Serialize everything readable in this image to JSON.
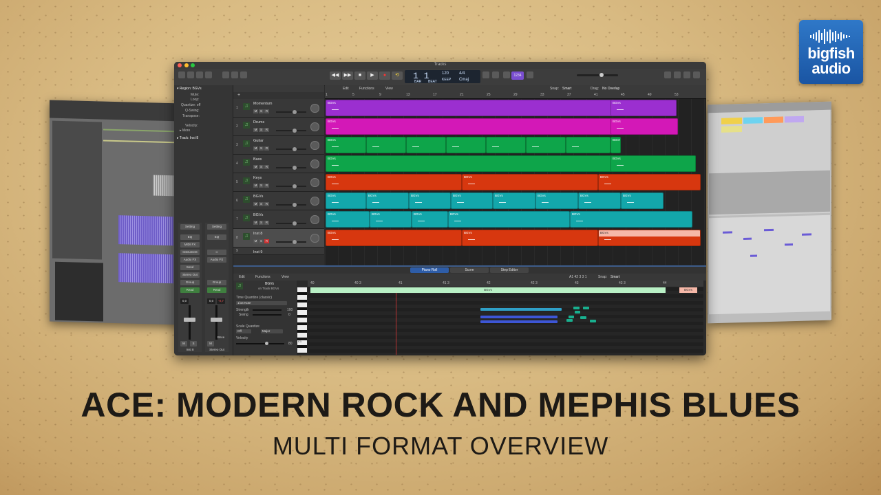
{
  "brand": {
    "line1": "bigfish",
    "line2": "audio",
    "color": "#1f5fae"
  },
  "title": "ACE: MODERN ROCK AND MEPHIS BLUES",
  "subtitle": "MULTI FORMAT OVERVIEW",
  "logic": {
    "window_title": "Tracks",
    "position_bars": "1 1",
    "tempo": "120",
    "time_signature": "4/4",
    "key": "Cmaj",
    "lcd_labels": {
      "bar": "BAR",
      "beat": "BEAT",
      "keep": "KEEP"
    },
    "counter": "1234",
    "menus": {
      "edit": "Edit",
      "functions": "Functions",
      "view": "View"
    },
    "snap_label": "Snap:",
    "snap_value": "Smart",
    "drag_label": "Drag:",
    "drag_value": "No Overlap",
    "inspector": {
      "region_header": "▾ Region: BGVs",
      "rows": [
        "Mute:",
        "Loop:",
        "Quantize:  off",
        "Q-Swing:",
        "Transpose:",
        "Velocity:",
        "▸ More"
      ],
      "track_header": "▸ Track: Inst 8",
      "strip_left": {
        "setting": "Setting",
        "eq": "EQ",
        "midi_fx": "MIDI FX",
        "instrument": "Instrument",
        "audio_fx": "Audio FX",
        "send": "Send",
        "output": "Stereo Out",
        "group": "Group",
        "auto": "Read",
        "value": "0,0",
        "m": "M",
        "s": "S",
        "name": "Inst 8"
      },
      "strip_right": {
        "setting": "Setting",
        "eq": "EQ",
        "link": "∞",
        "audio_fx": "Audio FX",
        "group": "Group",
        "auto": "Read",
        "value": "0,0",
        "value2": "-0,7",
        "m": "M",
        "bnce": "Bnce",
        "name": "Stereo Out"
      }
    },
    "ruler": [
      "1",
      "5",
      "9",
      "13",
      "17",
      "21",
      "25",
      "29",
      "33",
      "37",
      "41",
      "45",
      "49",
      "53"
    ],
    "tracks": [
      {
        "num": "1",
        "name": "Momentum",
        "m": "M",
        "s": "S",
        "r": "R"
      },
      {
        "num": "2",
        "name": "Drums",
        "m": "M",
        "s": "S",
        "r": "R"
      },
      {
        "num": "3",
        "name": "Guitar",
        "m": "M",
        "s": "S",
        "r": "R"
      },
      {
        "num": "4",
        "name": "Bass",
        "m": "M",
        "s": "S",
        "r": "R"
      },
      {
        "num": "5",
        "name": "Keys",
        "m": "M",
        "s": "S",
        "r": "R"
      },
      {
        "num": "6",
        "name": "BGVs",
        "m": "M",
        "s": "S",
        "r": "R"
      },
      {
        "num": "7",
        "name": "BGVs",
        "m": "M",
        "s": "S",
        "r": "R"
      },
      {
        "num": "8",
        "name": "Inst 8",
        "m": "M",
        "s": "S",
        "r": "R"
      },
      {
        "num": "9",
        "name": "Inst 9",
        "m": "M",
        "s": "S",
        "r": "R"
      }
    ],
    "region_label": "BGVs",
    "colors": {
      "purple": "#9b2fd0",
      "magenta": "#d318b7",
      "green": "#0ea54a",
      "red": "#d7370f",
      "teal": "#13a7ab",
      "salmon": "#f6b8a8"
    },
    "editor": {
      "tabs": [
        "Piano Roll",
        "Score",
        "Step Editor"
      ],
      "region_name": "BGVs",
      "region_sub": "on Track BGVs",
      "position": "A1  42 3 3 1",
      "snap_label": "Snap:",
      "snap_value": "Smart",
      "time_quantize": "Time Quantize (classic)",
      "quantize_value": "1/16 Note",
      "strength_label": "Strength",
      "strength_value": "100",
      "swing_label": "Swing",
      "swing_value": "0",
      "scale_quantize": "Scale Quantize",
      "scale_off": "Off",
      "scale_major": "Major",
      "velocity_label": "Velocity",
      "velocity_value": "80",
      "ruler": [
        "40",
        "40 3",
        "41",
        "41 3",
        "42",
        "42 3",
        "43",
        "43 3",
        "44"
      ],
      "region_label": "BGVs",
      "c_label": "C1"
    }
  }
}
